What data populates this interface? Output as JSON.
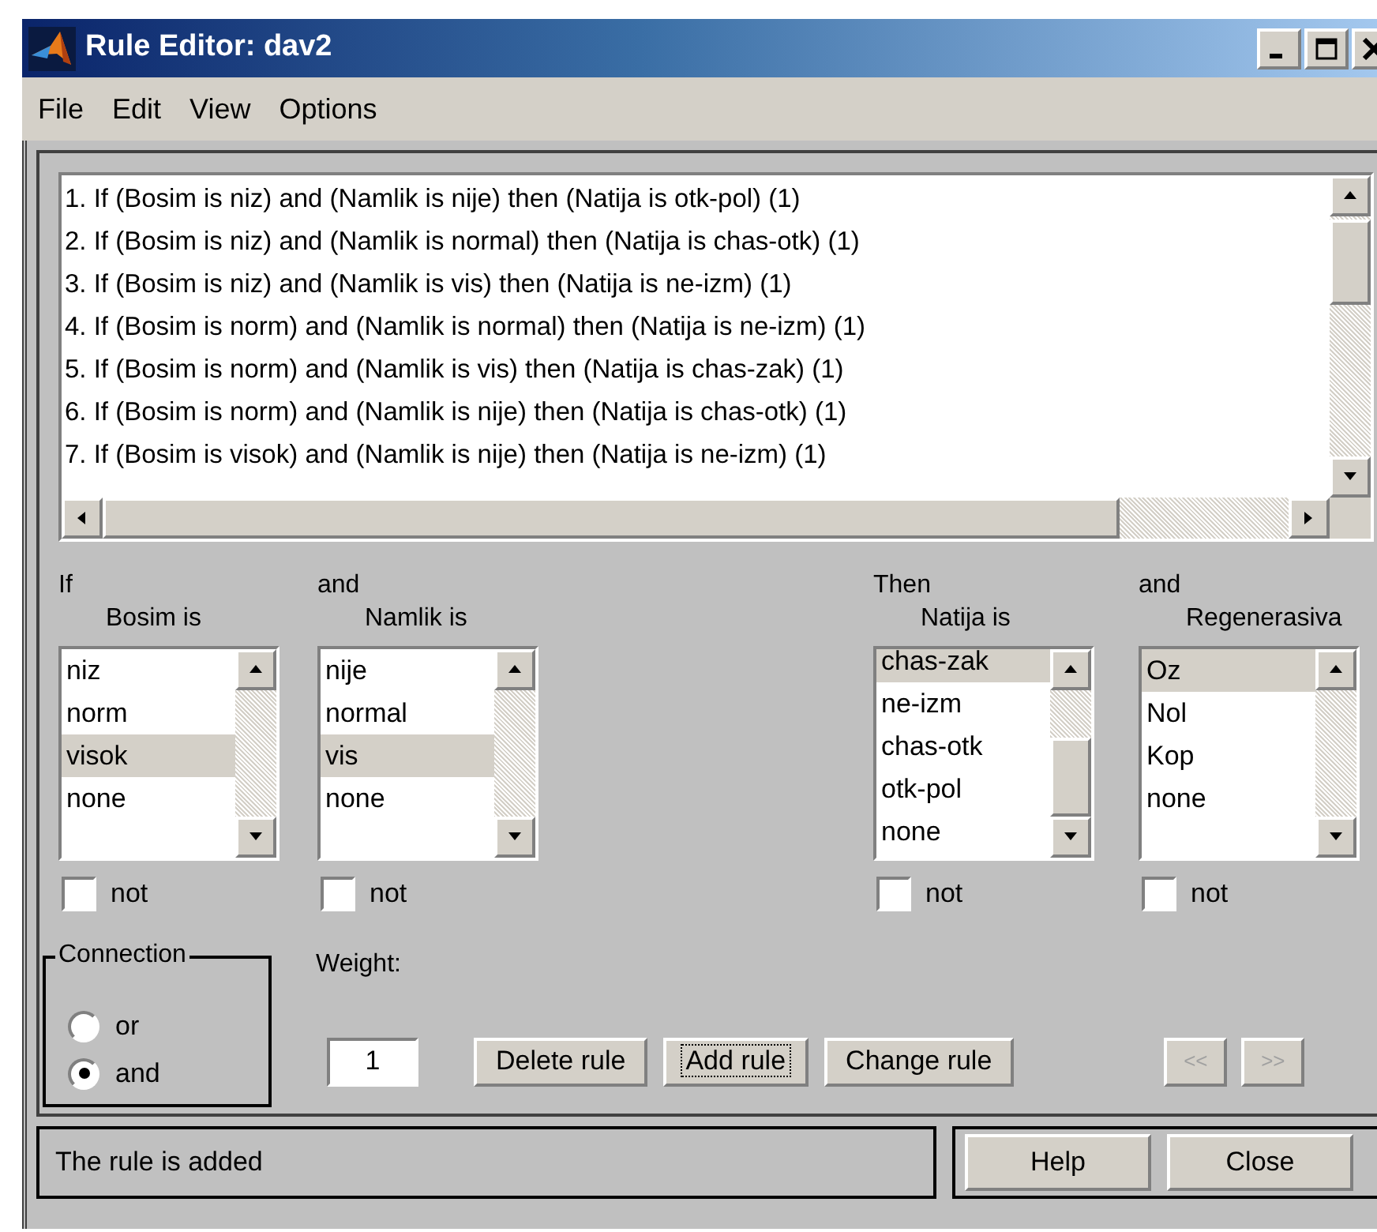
{
  "window": {
    "title": "Rule Editor: dav2"
  },
  "menu": [
    "File",
    "Edit",
    "View",
    "Options"
  ],
  "rules": [
    "1. If (Bosim is niz) and (Namlik is nije) then (Natija is otk-pol) (1)",
    "2. If (Bosim is niz) and (Namlik is normal) then (Natija is chas-otk) (1)",
    "3. If (Bosim is niz) and (Namlik is vis) then (Natija is ne-izm) (1)",
    "4. If (Bosim is norm) and (Namlik is normal) then (Natija is ne-izm) (1)",
    "5. If (Bosim is norm) and (Namlik is vis) then (Natija is chas-zak) (1)",
    "6. If (Bosim is norm) and (Namlik is nije) then (Natija is chas-otk) (1)",
    "7. If (Bosim is visok) and (Namlik is nije) then (Natija is ne-izm) (1)"
  ],
  "inputs": [
    {
      "prefix": "If",
      "label": "Bosim is",
      "not_label": "not",
      "not_checked": false,
      "items": [
        {
          "label": "niz",
          "selected": false
        },
        {
          "label": "norm",
          "selected": false
        },
        {
          "label": "visok",
          "selected": true
        },
        {
          "label": "none",
          "selected": false
        }
      ]
    },
    {
      "prefix": "and",
      "label": "Namlik is",
      "not_label": "not",
      "not_checked": false,
      "items": [
        {
          "label": "nije",
          "selected": false
        },
        {
          "label": "normal",
          "selected": false
        },
        {
          "label": "vis",
          "selected": true
        },
        {
          "label": "none",
          "selected": false
        }
      ]
    }
  ],
  "outputs": [
    {
      "prefix": "Then",
      "label": "Natija is",
      "not_label": "not",
      "not_checked": false,
      "items": [
        {
          "label": "chas-zak",
          "selected": true
        },
        {
          "label": "ne-izm",
          "selected": false
        },
        {
          "label": "chas-otk",
          "selected": false
        },
        {
          "label": "otk-pol",
          "selected": false
        },
        {
          "label": "none",
          "selected": false
        }
      ]
    },
    {
      "prefix": "and",
      "label": "Regenerasiva",
      "not_label": "not",
      "not_checked": false,
      "items": [
        {
          "label": "Oz",
          "selected": true
        },
        {
          "label": "Nol",
          "selected": false
        },
        {
          "label": "Kop",
          "selected": false
        },
        {
          "label": "none",
          "selected": false
        }
      ]
    }
  ],
  "connection": {
    "title": "Connection",
    "options": [
      {
        "label": "or",
        "selected": false
      },
      {
        "label": "and",
        "selected": true
      }
    ]
  },
  "weight": {
    "label": "Weight:",
    "value": "1"
  },
  "buttons": [
    {
      "label": "Delete rule",
      "focused": false
    },
    {
      "label": "Add rule",
      "focused": true
    },
    {
      "label": "Change rule",
      "focused": false
    }
  ],
  "nav_buttons": [
    {
      "label": "<<",
      "disabled": true
    },
    {
      "label": ">>",
      "disabled": true
    }
  ],
  "status": "The rule is added",
  "footer_buttons": [
    "Help",
    "Close"
  ]
}
